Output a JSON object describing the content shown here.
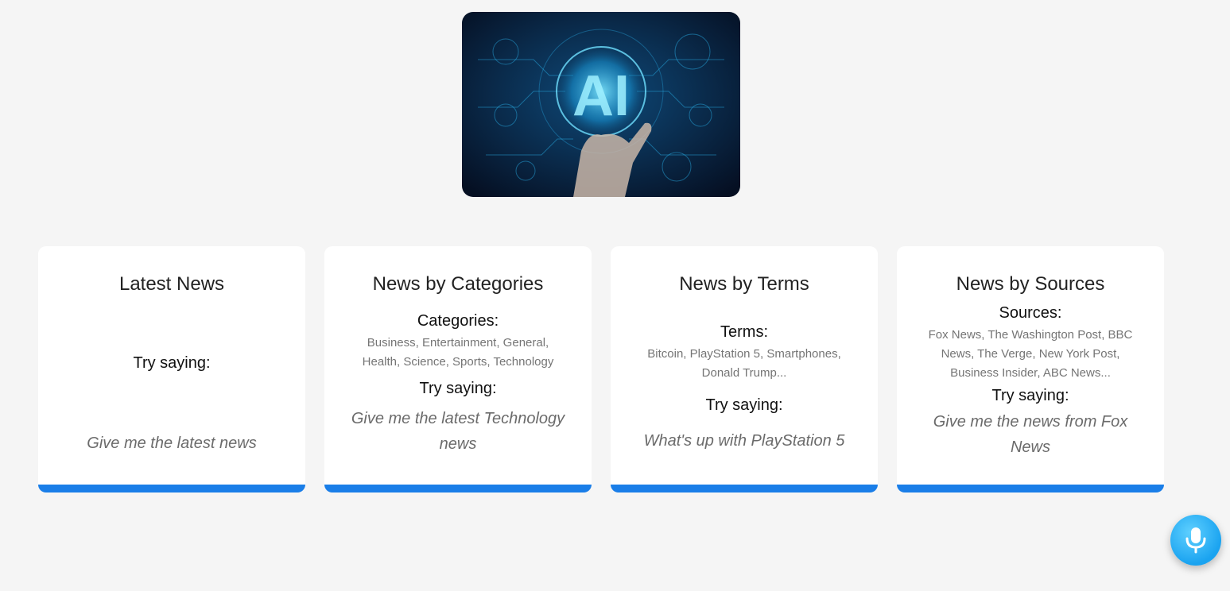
{
  "hero": {
    "logo_text": "AI"
  },
  "cards": [
    {
      "title": "Latest News",
      "try_label": "Try saying:",
      "example": "Give me the latest news"
    },
    {
      "title": "News by Categories",
      "list_label": "Categories:",
      "list_items": "Business, Entertainment, General, Health, Science, Sports, Technology",
      "try_label": "Try saying:",
      "example": "Give me the latest Technology news"
    },
    {
      "title": "News by Terms",
      "list_label": "Terms:",
      "list_items": "Bitcoin, PlayStation 5, Smartphones, Donald Trump...",
      "try_label": "Try saying:",
      "example": "What's up with PlayStation 5"
    },
    {
      "title": "News by Sources",
      "list_label": "Sources:",
      "list_items": "Fox News, The Washington Post, BBC News, The Verge, New York Post, Business Insider, ABC News...",
      "try_label": "Try saying:",
      "example": "Give me the news from Fox News"
    }
  ],
  "colors": {
    "background": "#f5f5f5",
    "card_accent": "#1a7ee8",
    "mic_button": "#1aa3f0"
  },
  "icons": {
    "mic_button": "microphone-icon"
  }
}
